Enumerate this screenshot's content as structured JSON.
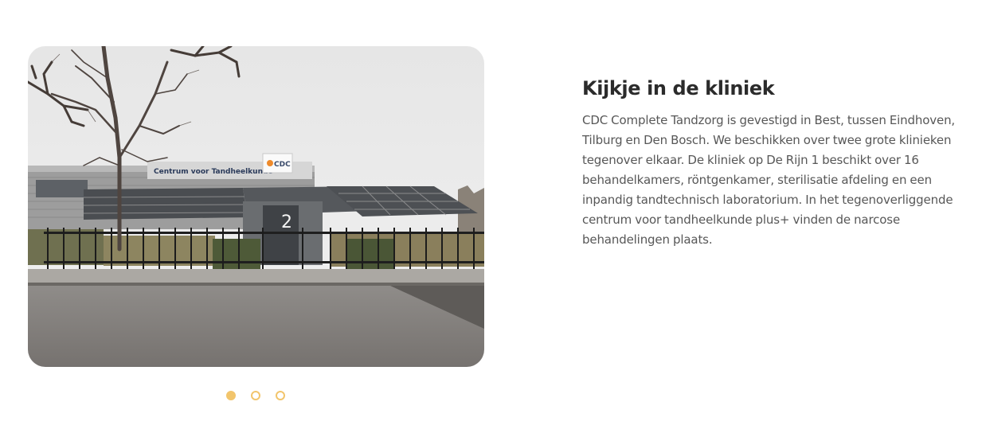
{
  "gallery": {
    "sign_main": "CDC",
    "sign_building": "Centrum voor Tandheelkunde",
    "house_number": "2",
    "dots": [
      {
        "active": true
      },
      {
        "active": false
      },
      {
        "active": false
      }
    ],
    "accent_color": "#f2c56c"
  },
  "section": {
    "title": "Kijkje in de kliniek",
    "body": "CDC Complete Tandzorg is gevestigd in Best, tussen Eindhoven, Tilburg en Den Bosch. We beschikken over twee grote klinieken tegenover elkaar. De kliniek op De Rijn 1 beschikt over 16 behandelkamers, röntgenkamer, sterilisatie afdeling en een inpandig tandtechnisch laboratorium. In het tegenoverliggende centrum voor tandheelkunde plus+ vinden de narcose behandelingen plaats."
  }
}
